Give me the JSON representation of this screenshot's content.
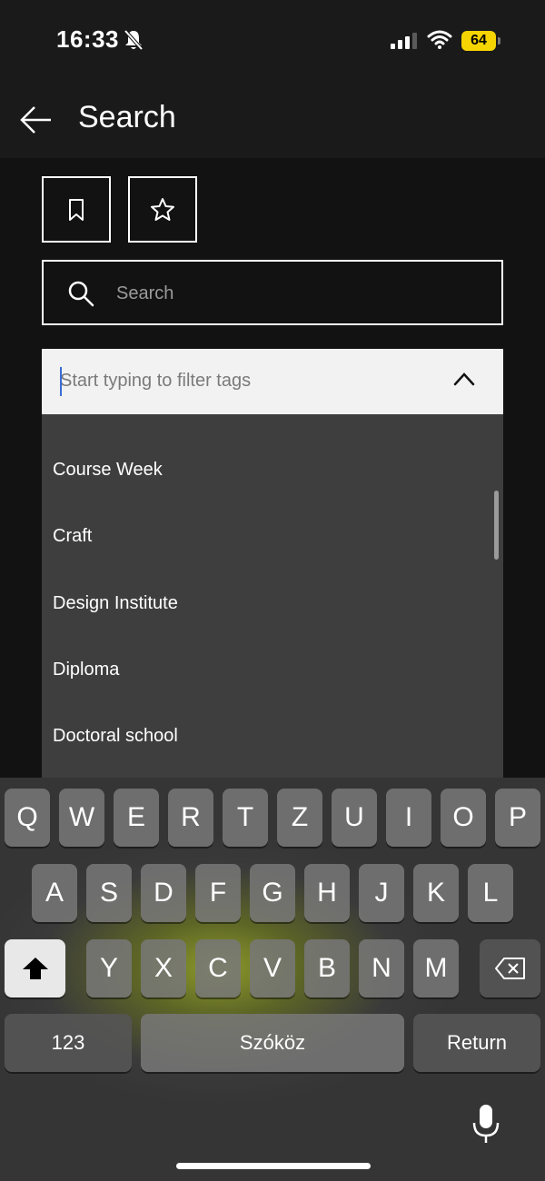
{
  "status_bar": {
    "time": "16:33",
    "battery": "64"
  },
  "header": {
    "title": "Search"
  },
  "search": {
    "placeholder": "Search"
  },
  "tag_filter": {
    "placeholder": "Start typing to filter tags",
    "items": [
      "Course Week",
      "Craft",
      "Design Institute",
      "Diploma",
      "Doctoral school"
    ]
  },
  "keyboard": {
    "row1": [
      "Q",
      "W",
      "E",
      "R",
      "T",
      "Z",
      "U",
      "I",
      "O",
      "P"
    ],
    "row2": [
      "A",
      "S",
      "D",
      "F",
      "G",
      "H",
      "J",
      "K",
      "L"
    ],
    "row3": [
      "Y",
      "X",
      "C",
      "V",
      "B",
      "N",
      "M"
    ],
    "numbers_label": "123",
    "space_label": "Szóköz",
    "return_label": "Return"
  },
  "colors": {
    "accent_battery": "#f5d400",
    "caret": "#3a6cd6",
    "list_bg": "#3e3e3e"
  }
}
